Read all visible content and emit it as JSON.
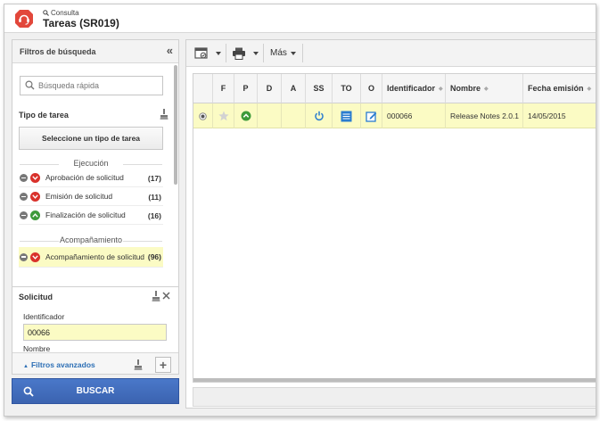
{
  "header": {
    "breadcrumb": "Consulta",
    "title": "Tareas (SR019)"
  },
  "filters": {
    "panel_title": "Filtros de búsqueda",
    "quick_search_placeholder": "Búsqueda rápida",
    "task_type_title": "Tipo de tarea",
    "select_task_type_label": "Seleccione un tipo de tarea",
    "execution_group": "Ejecución",
    "execution_items": [
      {
        "label": "Aprobación de solicitud",
        "count": "(17)",
        "status": "red"
      },
      {
        "label": "Emisión de solicitud",
        "count": "(11)",
        "status": "red"
      },
      {
        "label": "Finalización de solicitud",
        "count": "(16)",
        "status": "green"
      }
    ],
    "tracking_group": "Acompañamiento",
    "tracking_items": [
      {
        "label": "Acompañamiento de solicitud",
        "count": "(96)",
        "status": "red"
      }
    ],
    "request_title": "Solicitud",
    "identifier_label": "Identificador",
    "identifier_value": "00066",
    "name_label": "Nombre",
    "advanced_filters_label": "Filtros avanzados",
    "search_button_label": "BUSCAR"
  },
  "toolbar": {
    "more_label": "Más"
  },
  "grid": {
    "columns": [
      "F",
      "P",
      "D",
      "A",
      "SS",
      "TO",
      "O",
      "Identificador",
      "Nombre",
      "Fecha emisión"
    ],
    "rows": [
      {
        "identifier": "000066",
        "name": "Release Notes 2.0.1",
        "issue_date": "14/05/2015"
      }
    ]
  },
  "colors": {
    "accent": "#3b63b0",
    "highlight": "#fbfbc4",
    "status_red": "#d9312b",
    "status_green": "#3d9a3a",
    "logo": "#e2473b"
  }
}
